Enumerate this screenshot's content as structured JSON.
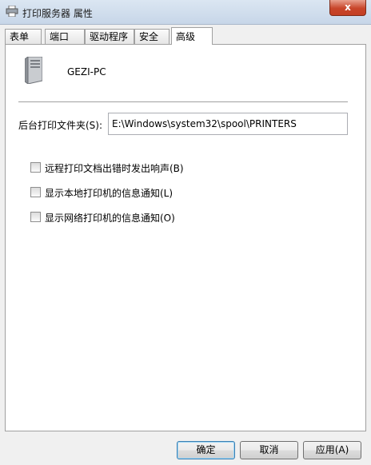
{
  "window": {
    "title": "打印服务器 属性",
    "close_label": "x"
  },
  "tabs": [
    {
      "label": "表单",
      "active": false
    },
    {
      "label": "端口",
      "active": false
    },
    {
      "label": "驱动程序",
      "active": false
    },
    {
      "label": "安全",
      "active": false
    },
    {
      "label": "高级",
      "active": true
    }
  ],
  "server": {
    "name": "GEZI-PC",
    "icon": "computer-tower-icon"
  },
  "spool": {
    "label": "后台打印文件夹(S):",
    "value": "E:\\Windows\\system32\\spool\\PRINTERS"
  },
  "options": [
    {
      "label": "远程打印文档出错时发出响声(B)",
      "checked": false
    },
    {
      "label": "显示本地打印机的信息通知(L)",
      "checked": false
    },
    {
      "label": "显示网络打印机的信息通知(O)",
      "checked": false
    }
  ],
  "buttons": {
    "ok": "确定",
    "cancel": "取消",
    "apply": "应用(A)"
  }
}
